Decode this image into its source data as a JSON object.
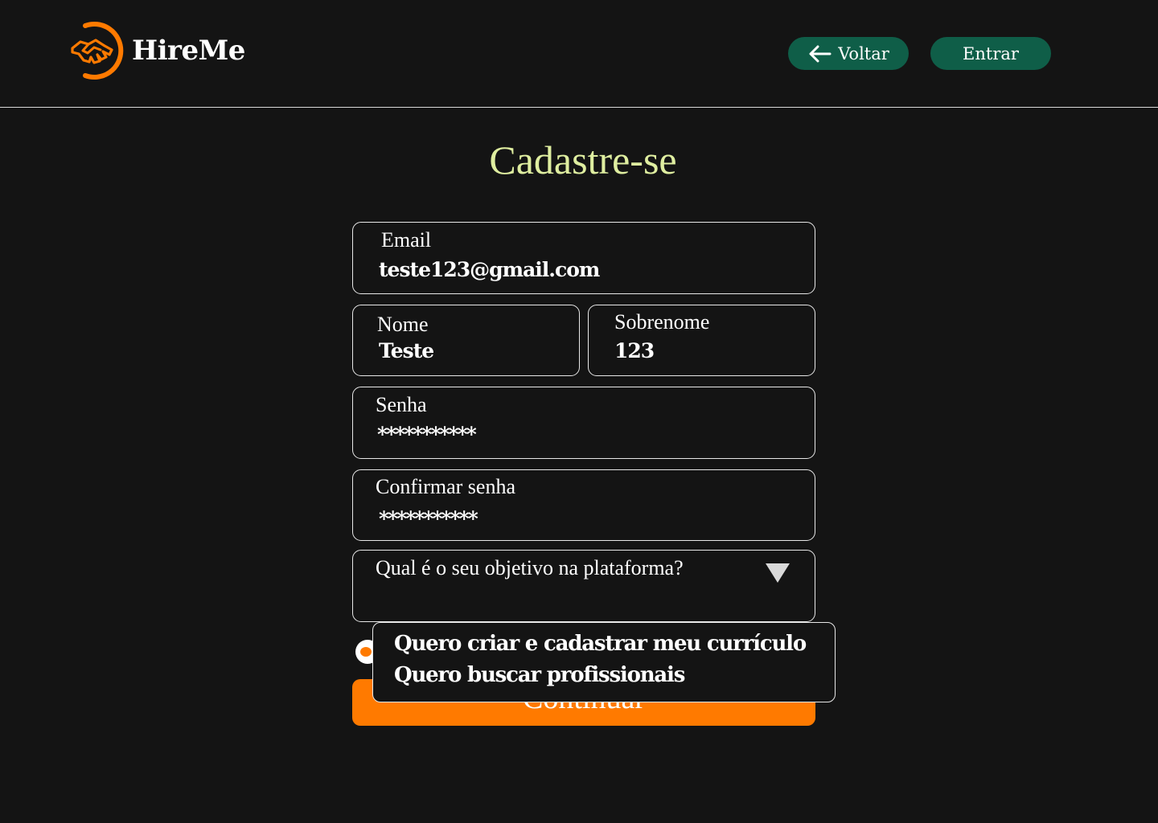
{
  "header": {
    "logo_text": "HireMe",
    "back_label": "Voltar",
    "login_label": "Entrar"
  },
  "title": "Cadastre-se",
  "form": {
    "email": {
      "label": "Email",
      "value": "teste123@gmail.com"
    },
    "first_name": {
      "label": "Nome",
      "value": "Teste"
    },
    "last_name": {
      "label": "Sobrenome",
      "value": "123"
    },
    "password": {
      "label": "Senha",
      "value": "***********"
    },
    "confirm_password": {
      "label": "Confirmar senha",
      "value": "***********"
    },
    "goal": {
      "label": "Qual é o seu objetivo na plataforma?",
      "options": [
        "Quero criar e cadastrar meu currículo",
        "Quero buscar profissionais"
      ]
    },
    "continue_label": "Continuar"
  },
  "colors": {
    "background": "#141414",
    "accent_orange": "#ff7a00",
    "nav_green": "#0f5e48",
    "title_green": "#dfeea0",
    "border": "#e8e8e8"
  },
  "icons": {
    "logo": "handshake-icon",
    "back": "arrow-left-icon",
    "select": "triangle-down-icon"
  }
}
